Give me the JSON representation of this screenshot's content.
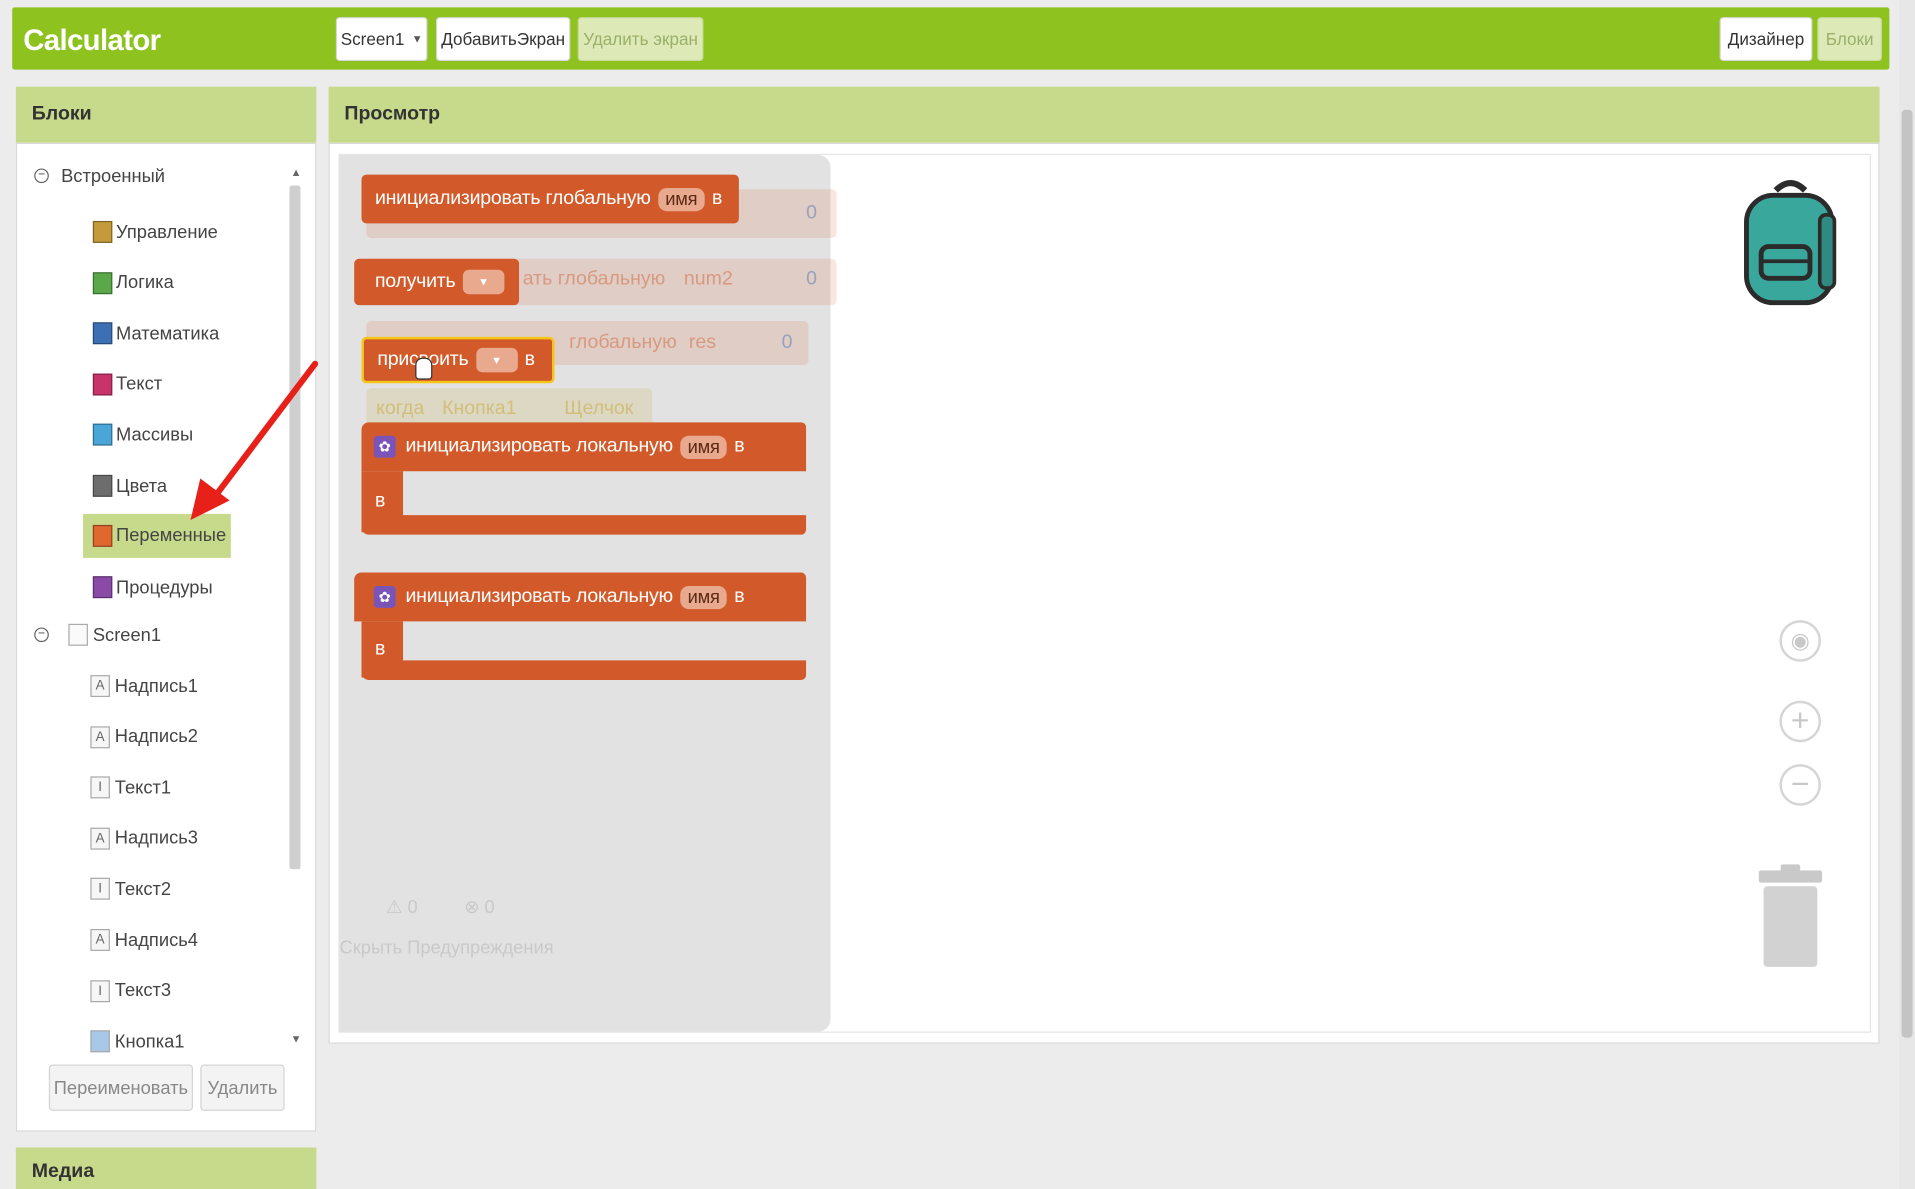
{
  "app": {
    "title": "Calculator"
  },
  "toolbar": {
    "screen_select": "Screen1",
    "add_screen": "ДобавитьЭкран",
    "remove_screen": "Удалить экран",
    "designer": "Дизайнер",
    "blocks": "Блоки"
  },
  "sidebar": {
    "header": "Блоки",
    "builtin": {
      "label": "Встроенный",
      "items": [
        {
          "label": "Управление",
          "color": "#c49a3a"
        },
        {
          "label": "Логика",
          "color": "#5aa84a"
        },
        {
          "label": "Математика",
          "color": "#3c6fb4"
        },
        {
          "label": "Текст",
          "color": "#c8336a"
        },
        {
          "label": "Массивы",
          "color": "#4aa6d6"
        },
        {
          "label": "Цвета",
          "color": "#6d6d6d"
        },
        {
          "label": "Переменные",
          "color": "#e0672e"
        },
        {
          "label": "Процедуры",
          "color": "#8a4aa6"
        }
      ]
    },
    "screen": {
      "label": "Screen1",
      "items": [
        {
          "label": "Надпись1",
          "icon": "A"
        },
        {
          "label": "Надпись2",
          "icon": "A"
        },
        {
          "label": "Текст1",
          "icon": "I"
        },
        {
          "label": "Надпись3",
          "icon": "A"
        },
        {
          "label": "Текст2",
          "icon": "I"
        },
        {
          "label": "Надпись4",
          "icon": "A"
        },
        {
          "label": "Текст3",
          "icon": "I"
        },
        {
          "label": "Кнопка1",
          "icon": "button"
        }
      ]
    },
    "rename_button": "Переименовать",
    "delete_button": "Удалить",
    "media_header": "Медиа"
  },
  "viewer": {
    "header": "Просмотр",
    "blocks": {
      "init_global": "инициализировать глобальную",
      "name_chip": "имя",
      "to": "в",
      "get": "получить",
      "set": "присвоить",
      "init_local": "инициализировать локальную",
      "in": "в"
    },
    "ghost": {
      "t1": "ать глобальную",
      "num2": "num2",
      "v0": "0",
      "t2": "глобальную",
      "res": "res",
      "when": "когда",
      "button1": "Кнопка1",
      "click": "Щелчок"
    },
    "warnings": {
      "warn_count": "0",
      "error_count": "0",
      "hide_label": "Скрыть Предупреждения"
    }
  },
  "colors": {
    "topbar": "#8dc21f",
    "panel_header": "#c7da8b",
    "variables_block": "#d25a2a",
    "highlight": "#c7da8b",
    "arrow": "#e8201a"
  }
}
